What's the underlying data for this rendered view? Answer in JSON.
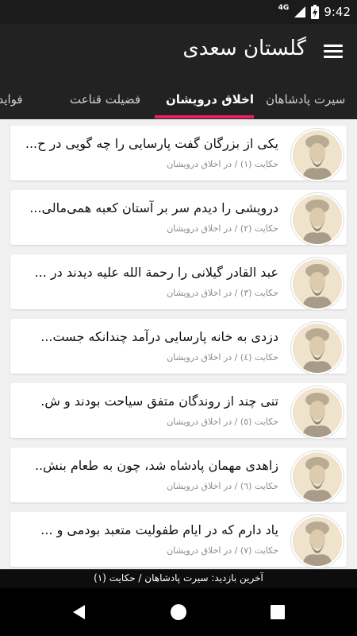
{
  "status_bar": {
    "network": "4G",
    "time": "9:42"
  },
  "app_bar": {
    "title": "گلستان سعدی",
    "menu_icon": "hamburger-menu-icon"
  },
  "tabs": [
    {
      "label": "سیرت پادشاهان",
      "active": false
    },
    {
      "label": "اخلاق درویشان",
      "active": true
    },
    {
      "label": "فضیلت قناعت",
      "active": false
    },
    {
      "label": "فواید خاموشی",
      "active": false
    }
  ],
  "accent_color": "#e91e63",
  "items": [
    {
      "title": "یکی از بزرگان گفت پارسایی را چه گویی در ح...",
      "subtitle": "حکایت (۱) / در اخلاق درویشان"
    },
    {
      "title": "درویشی را دیدم سر بر آستان کعبه همی‌مالی...",
      "subtitle": "حکایت (۲) / در اخلاق درویشان"
    },
    {
      "title": "عبد القادر گیلانی را رحمة الله علیه دیدند در ...",
      "subtitle": "حکایت (۳) / در اخلاق درویشان"
    },
    {
      "title": "دزدی به خانه پارسایی درآمد چندانکه جست...",
      "subtitle": "حکایت (٤) / در اخلاق درویشان"
    },
    {
      "title": "تنی چند از روندگان متفق سیاحت بودند و ش.",
      "subtitle": "حکایت (٥) / در اخلاق درویشان"
    },
    {
      "title": "زاهدی مهمان پادشاه شد، چون به طعام بنش..",
      "subtitle": "حکایت (٦) / در اخلاق درویشان"
    },
    {
      "title": "یاد دارم که در ایام طفولیت متعبد بودمی و ...",
      "subtitle": "حکایت (۷) / در اخلاق درویشان"
    }
  ],
  "last_visit": "آخرین بازدید: سیرت پادشاهان / حکایت (۱)"
}
